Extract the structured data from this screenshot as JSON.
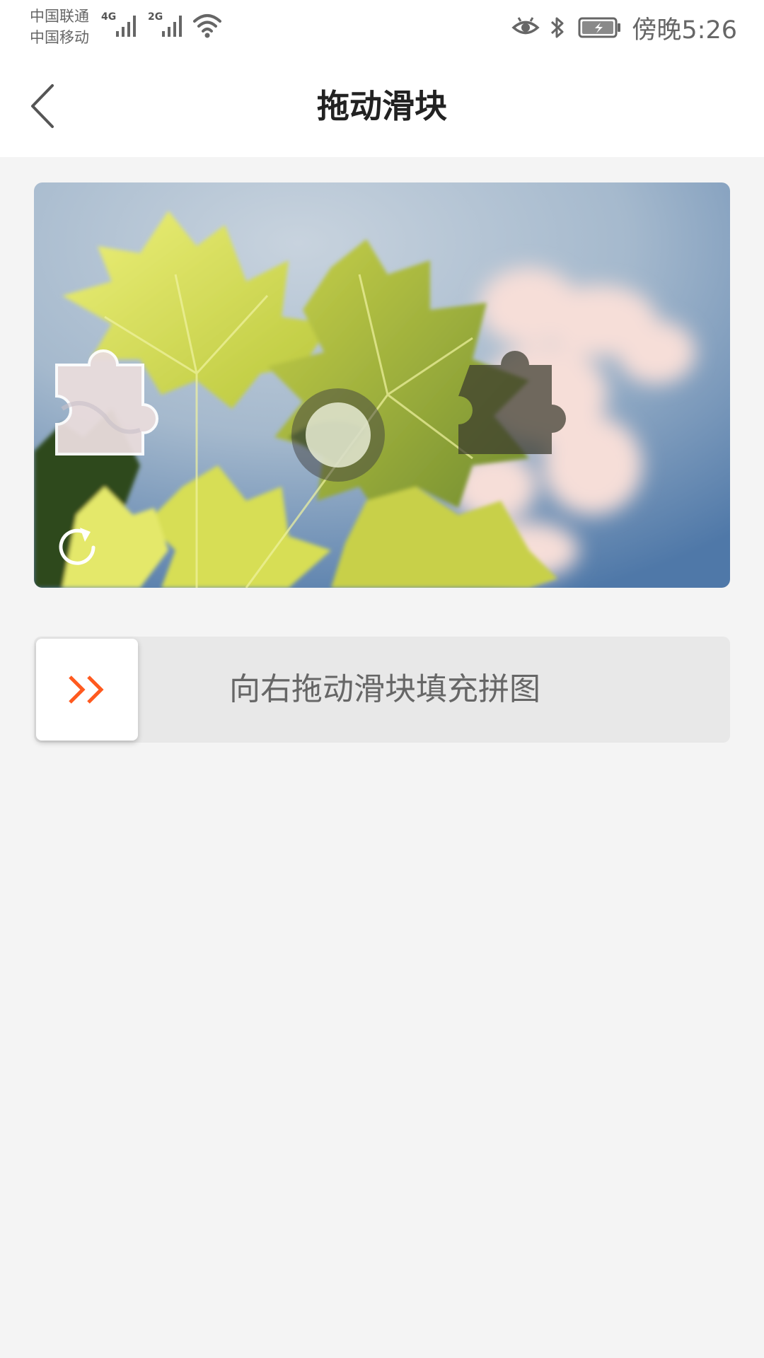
{
  "status_bar": {
    "carrier_1": "中国联通",
    "carrier_2": "中国移动",
    "network_1": "4G",
    "network_2": "2G",
    "time": "傍晚5:26",
    "icons": [
      "signal-icon",
      "signal-icon",
      "wifi-icon",
      "eye-icon",
      "bluetooth-icon",
      "battery-charging-icon"
    ]
  },
  "header": {
    "title": "拖动滑块",
    "back_icon": "chevron-left-icon"
  },
  "captcha": {
    "refresh_icon": "refresh-icon",
    "slider": {
      "label": "向右拖动滑块填充拼图",
      "handle_icon": "double-chevron-right-icon",
      "position": 0
    }
  },
  "colors": {
    "accent": "#ff5a1f",
    "background": "#f4f4f4",
    "track": "#e8e8e8",
    "title": "#222222",
    "text": "#666666"
  }
}
